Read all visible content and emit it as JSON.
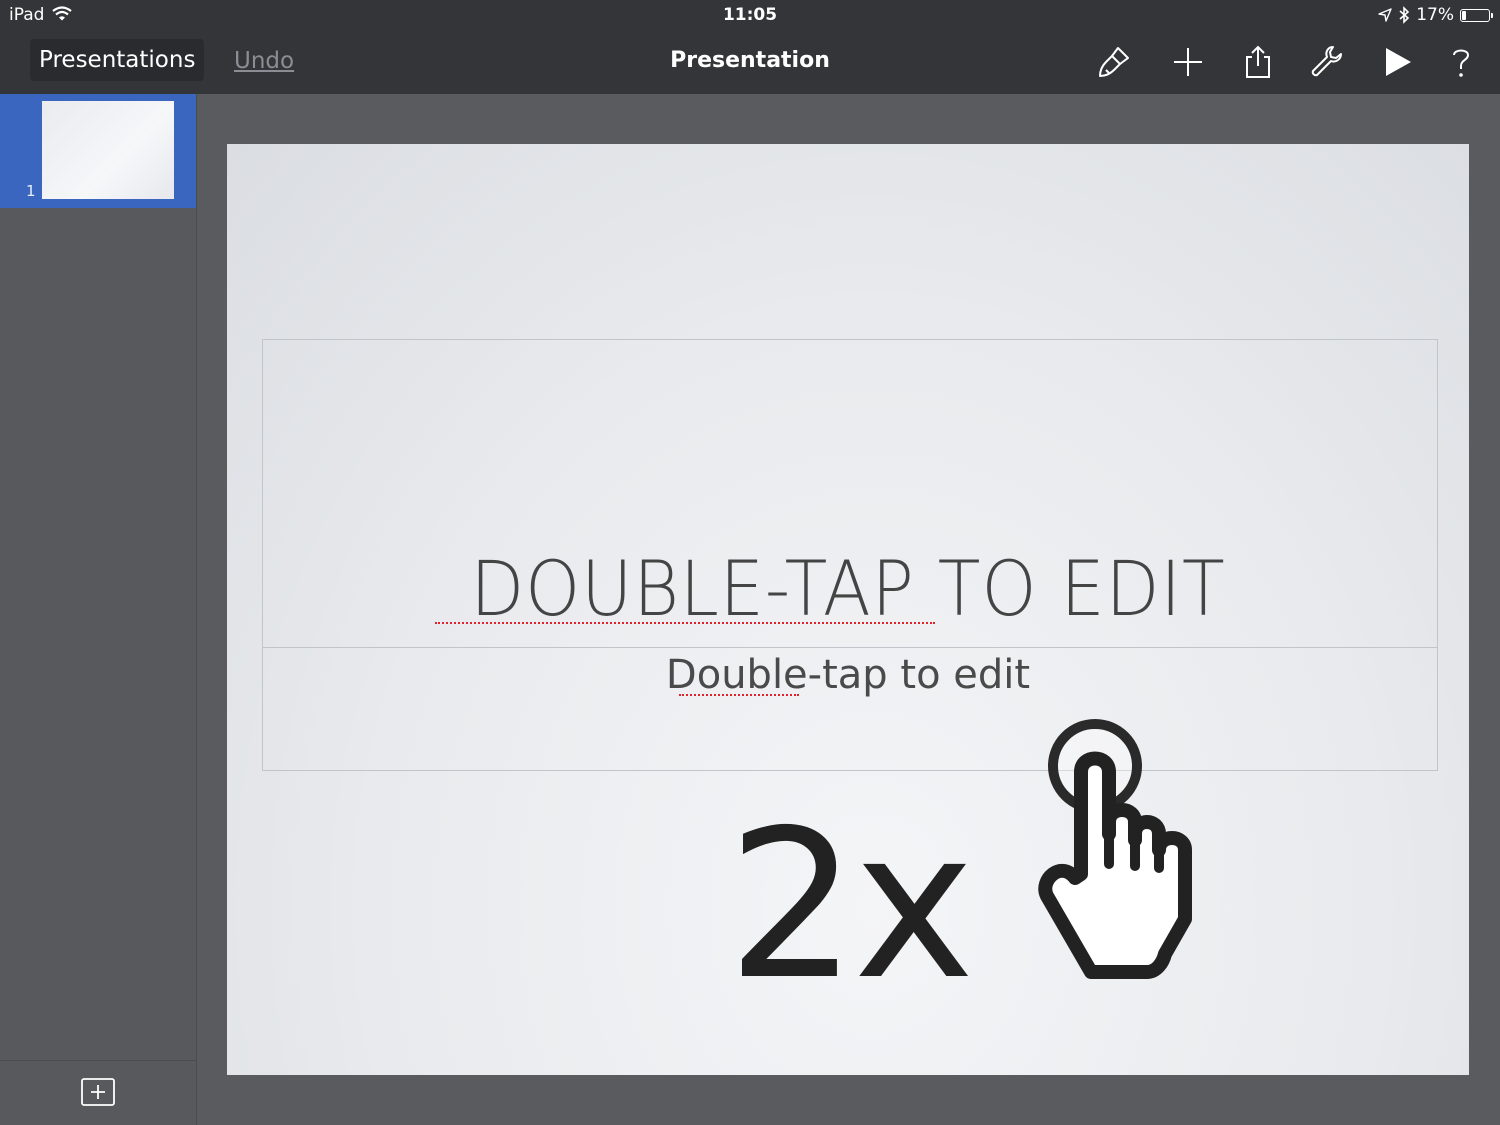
{
  "status_bar": {
    "device": "iPad",
    "time": "11:05",
    "battery": "17%",
    "battery_level": 0.17
  },
  "toolbar": {
    "back_label": "Presentations",
    "undo_label": "Undo",
    "title": "Presentation",
    "icons": [
      "paintbrush-icon",
      "plus-icon",
      "share-icon",
      "wrench-icon",
      "play-icon",
      "help-icon"
    ]
  },
  "sidebar": {
    "slides": [
      {
        "number": "1"
      }
    ],
    "add_slide_icon": "plus-square-icon"
  },
  "slide": {
    "title": "DOUBLE-TAP TO EDIT",
    "subtitle": "Double-tap to edit"
  },
  "gesture_hint": {
    "count": "2x",
    "icon": "tap-hand-icon"
  },
  "colors": {
    "toolbar_bg": "#343538",
    "selected_thumb": "#3a66c0",
    "canvas_bg": "#5a5b5f"
  }
}
